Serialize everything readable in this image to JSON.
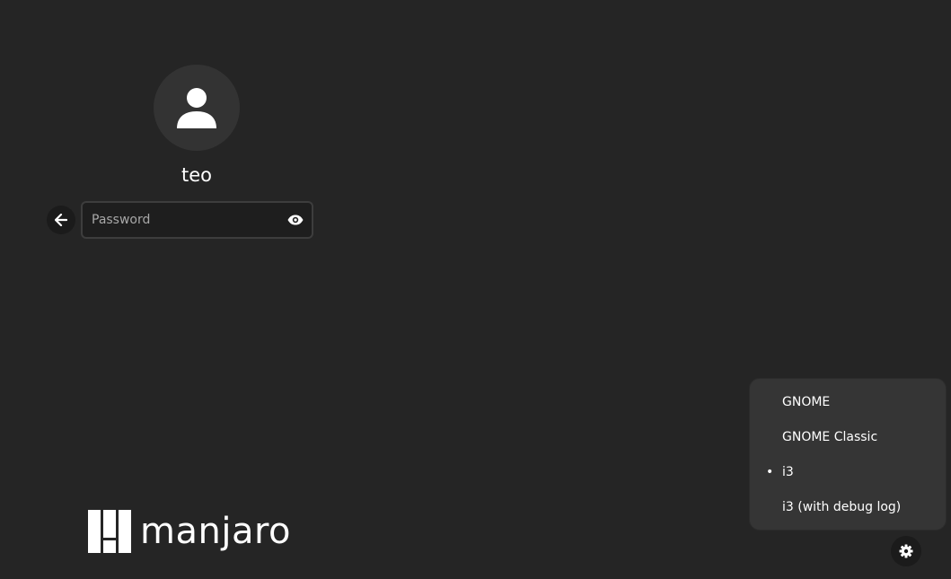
{
  "user": {
    "name": "teo",
    "avatar_icon": "user-icon"
  },
  "login": {
    "back_icon": "arrow-left-icon",
    "password_placeholder": "Password",
    "password_value": "",
    "reveal_icon": "eye-icon"
  },
  "branding": {
    "logo_icon": "manjaro-logo-icon",
    "logo_text": "manjaro"
  },
  "session_menu": {
    "items": [
      {
        "label": "GNOME",
        "selected": false
      },
      {
        "label": "GNOME Classic",
        "selected": false
      },
      {
        "label": "i3",
        "selected": true
      },
      {
        "label": "i3 (with debug log)",
        "selected": false
      }
    ],
    "selected_marker": "•"
  },
  "settings": {
    "icon": "gear-icon"
  },
  "colors": {
    "background": "#252525",
    "menu_background": "#353535",
    "entry_background": "#1e1e1e",
    "text": "#ffffff",
    "placeholder": "#a8a8a8"
  }
}
